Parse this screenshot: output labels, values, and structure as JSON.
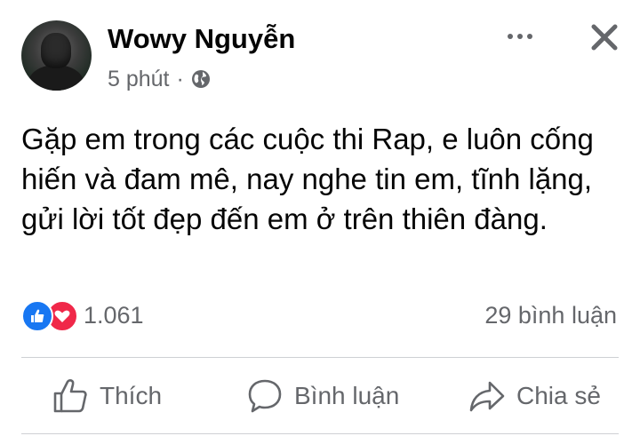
{
  "post": {
    "author_name": "Wowy Nguyễn",
    "time": "5 phút",
    "separator": "·",
    "privacy_icon": "globe-icon",
    "text": "Gặp em trong các cuộc thi Rap, e luôn cống hiến và đam mê, nay nghe tin em, tĩnh lặng, gửi lời tốt đẹp đến em ở trên thiên đàng."
  },
  "header": {
    "more_icon": "more-options-icon",
    "close_icon": "close-icon"
  },
  "stats": {
    "reaction_icons": [
      "like-reaction-icon",
      "love-reaction-icon"
    ],
    "reaction_count": "1.061",
    "comment_count": "29 bình luận"
  },
  "actions": {
    "like_label": "Thích",
    "comment_label": "Bình luận",
    "share_label": "Chia sẻ"
  },
  "colors": {
    "secondary_text": "#65676b",
    "like_blue": "#1877f2",
    "love_red": "#f02849",
    "divider": "#ced0d4"
  }
}
